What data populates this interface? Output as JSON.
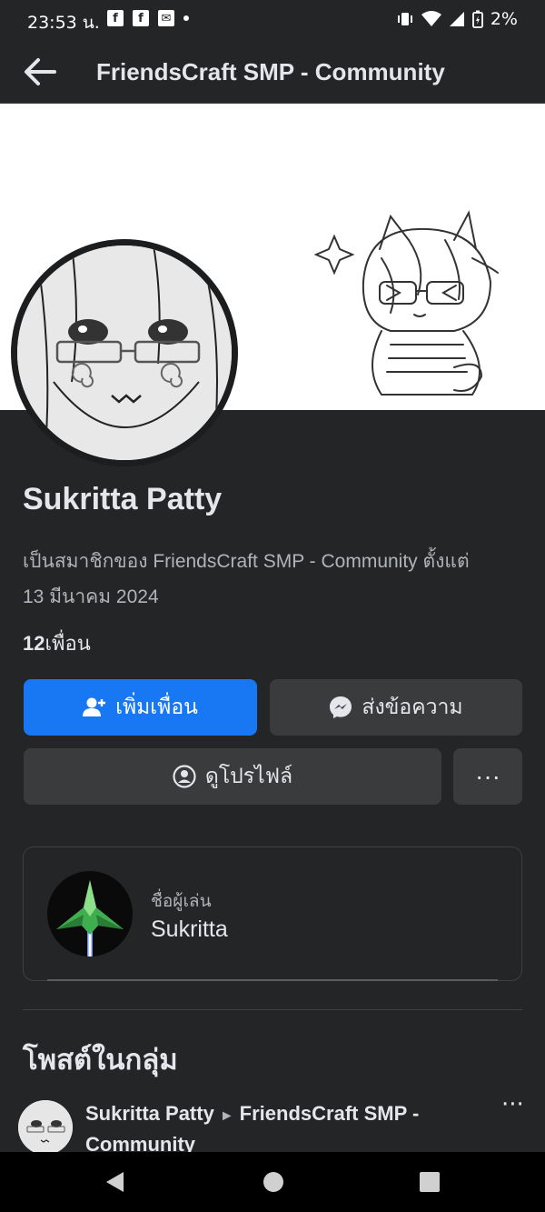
{
  "status_bar": {
    "time": "23:53 น.",
    "notifications": [
      "facebook-icon",
      "facebook-icon",
      "mail-icon"
    ],
    "battery": "2%"
  },
  "app_bar": {
    "title": "FriendsCraft SMP - Community"
  },
  "profile": {
    "name": "Sukritta Patty",
    "member_line1": "เป็นสมาชิกของ FriendsCraft SMP - Community ตั้งแต่",
    "member_line2": "13 มีนาคม  2024",
    "friends_count": "12",
    "friends_label": "เพื่อน"
  },
  "actions": {
    "add_friend": "เพิ่มเพื่อน",
    "message": "ส่งข้อความ",
    "view_profile": "ดูโปรไฟล์",
    "more": "···"
  },
  "player_card": {
    "label": "ชื่อผู้เล่น",
    "value": "Sukritta"
  },
  "posts_section": {
    "title": "โพสต์ในกลุ่ม",
    "post_author": "Sukritta Patty",
    "post_arrow": "►",
    "post_group": "FriendsCraft SMP - Community",
    "more": "···"
  },
  "colors": {
    "background": "#242526",
    "primary_button": "#1877f2",
    "secondary_button": "#3a3b3c",
    "text": "#e4e6eb",
    "muted_text": "#b0b3b8"
  }
}
